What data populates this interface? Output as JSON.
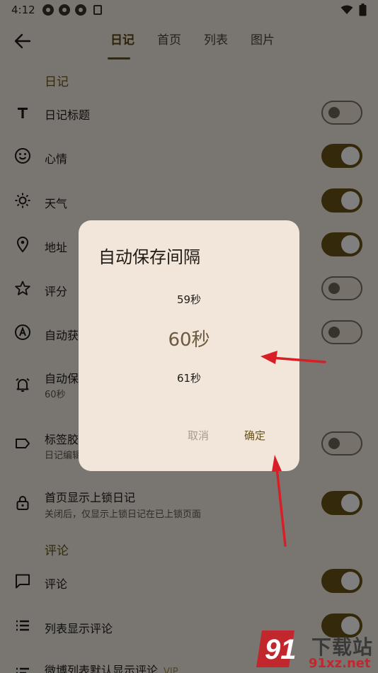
{
  "status_bar": {
    "time": "4:12"
  },
  "tabs": [
    {
      "label": "日记",
      "active": true
    },
    {
      "label": "首页",
      "active": false
    },
    {
      "label": "列表",
      "active": false
    },
    {
      "label": "图片",
      "active": false
    }
  ],
  "sections": {
    "diary_title": "日记",
    "comment_title": "评论"
  },
  "rows": {
    "diary_title": {
      "label": "日记标题",
      "icon": "text-icon",
      "on": false
    },
    "mood": {
      "label": "心情",
      "icon": "smile-icon",
      "on": true
    },
    "weather": {
      "label": "天气",
      "icon": "sun-icon",
      "on": true
    },
    "address": {
      "label": "地址",
      "icon": "location-icon",
      "on": true
    },
    "rating": {
      "label": "评分",
      "icon": "star-icon",
      "on": false
    },
    "auto_fetch": {
      "label": "自动获",
      "icon": "auto-icon",
      "on": false
    },
    "auto_save": {
      "label": "自动保",
      "sub": "60秒",
      "icon": "alarm-icon"
    },
    "tag_capsule": {
      "label": "标签胶",
      "sub": "日记编辑",
      "icon": "label-icon",
      "on": false
    },
    "lock_diary": {
      "label": "首页显示上锁日记",
      "sub": "关闭后，仅显示上锁日记在已上锁页面",
      "icon": "lock-icon",
      "on": true
    },
    "comment": {
      "label": "评论",
      "icon": "comment-icon",
      "on": true
    },
    "list_comment": {
      "label": "列表显示评论",
      "icon": "list-icon",
      "on": true
    },
    "weibo_comment": {
      "label": "微博列表默认显示评论",
      "badge": "VIP",
      "icon": "list-sort-icon"
    }
  },
  "dialog": {
    "title": "自动保存间隔",
    "picker": {
      "prev": "59秒",
      "current": "60秒",
      "next": "61秒"
    },
    "cancel_label": "取消",
    "ok_label": "确定"
  },
  "watermark": {
    "text": "下载站",
    "url": "91xz.net"
  },
  "colors": {
    "accent": "#6b5316",
    "background": "#f3ece2",
    "dialog_background": "#f1e6d9",
    "annotation_arrow": "#d81f26"
  }
}
